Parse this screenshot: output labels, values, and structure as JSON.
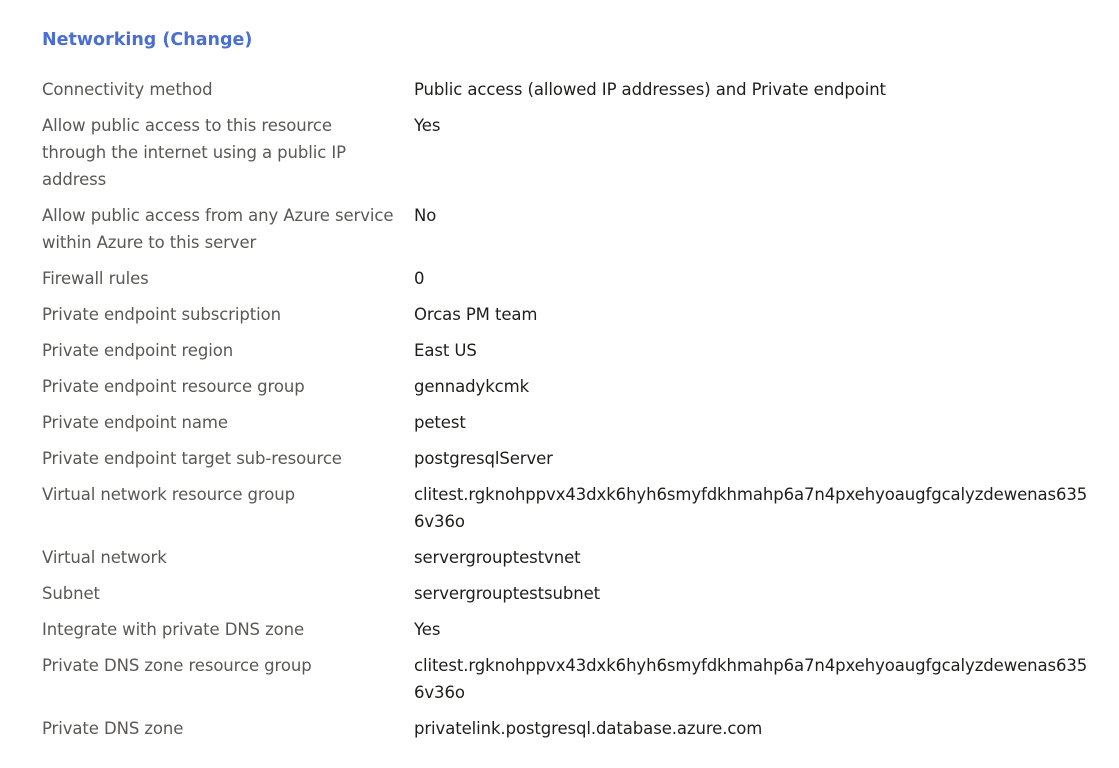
{
  "section": {
    "title": "Networking",
    "change_link": "(Change)"
  },
  "rows": [
    {
      "label": "Connectivity method",
      "value": "Public access (allowed IP addresses) and Private endpoint"
    },
    {
      "label": "Allow public access to this resource through the internet using a public IP address",
      "value": "Yes"
    },
    {
      "label": "Allow public access from any Azure service within Azure to this server",
      "value": "No"
    },
    {
      "label": "Firewall rules",
      "value": "0"
    },
    {
      "label": "Private endpoint subscription",
      "value": "Orcas PM team"
    },
    {
      "label": "Private endpoint region",
      "value": "East US"
    },
    {
      "label": "Private endpoint resource group",
      "value": "gennadykcmk"
    },
    {
      "label": "Private endpoint name",
      "value": "petest"
    },
    {
      "label": "Private endpoint target sub-resource",
      "value": "postgresqlServer"
    },
    {
      "label": "Virtual network resource group",
      "value": "clitest.rgknohppvx43dxk6hyh6smyfdkhmahp6a7n4pxehyoaugfgcalyzdewenas6356v36o"
    },
    {
      "label": "Virtual network",
      "value": "servergrouptestvnet"
    },
    {
      "label": "Subnet",
      "value": "servergrouptestsubnet"
    },
    {
      "label": "Integrate with private DNS zone",
      "value": "Yes"
    },
    {
      "label": "Private DNS zone resource group",
      "value": "clitest.rgknohppvx43dxk6hyh6smyfdkhmahp6a7n4pxehyoaugfgcalyzdewenas6356v36o"
    },
    {
      "label": "Private DNS zone",
      "value": "privatelink.postgresql.database.azure.com"
    }
  ]
}
